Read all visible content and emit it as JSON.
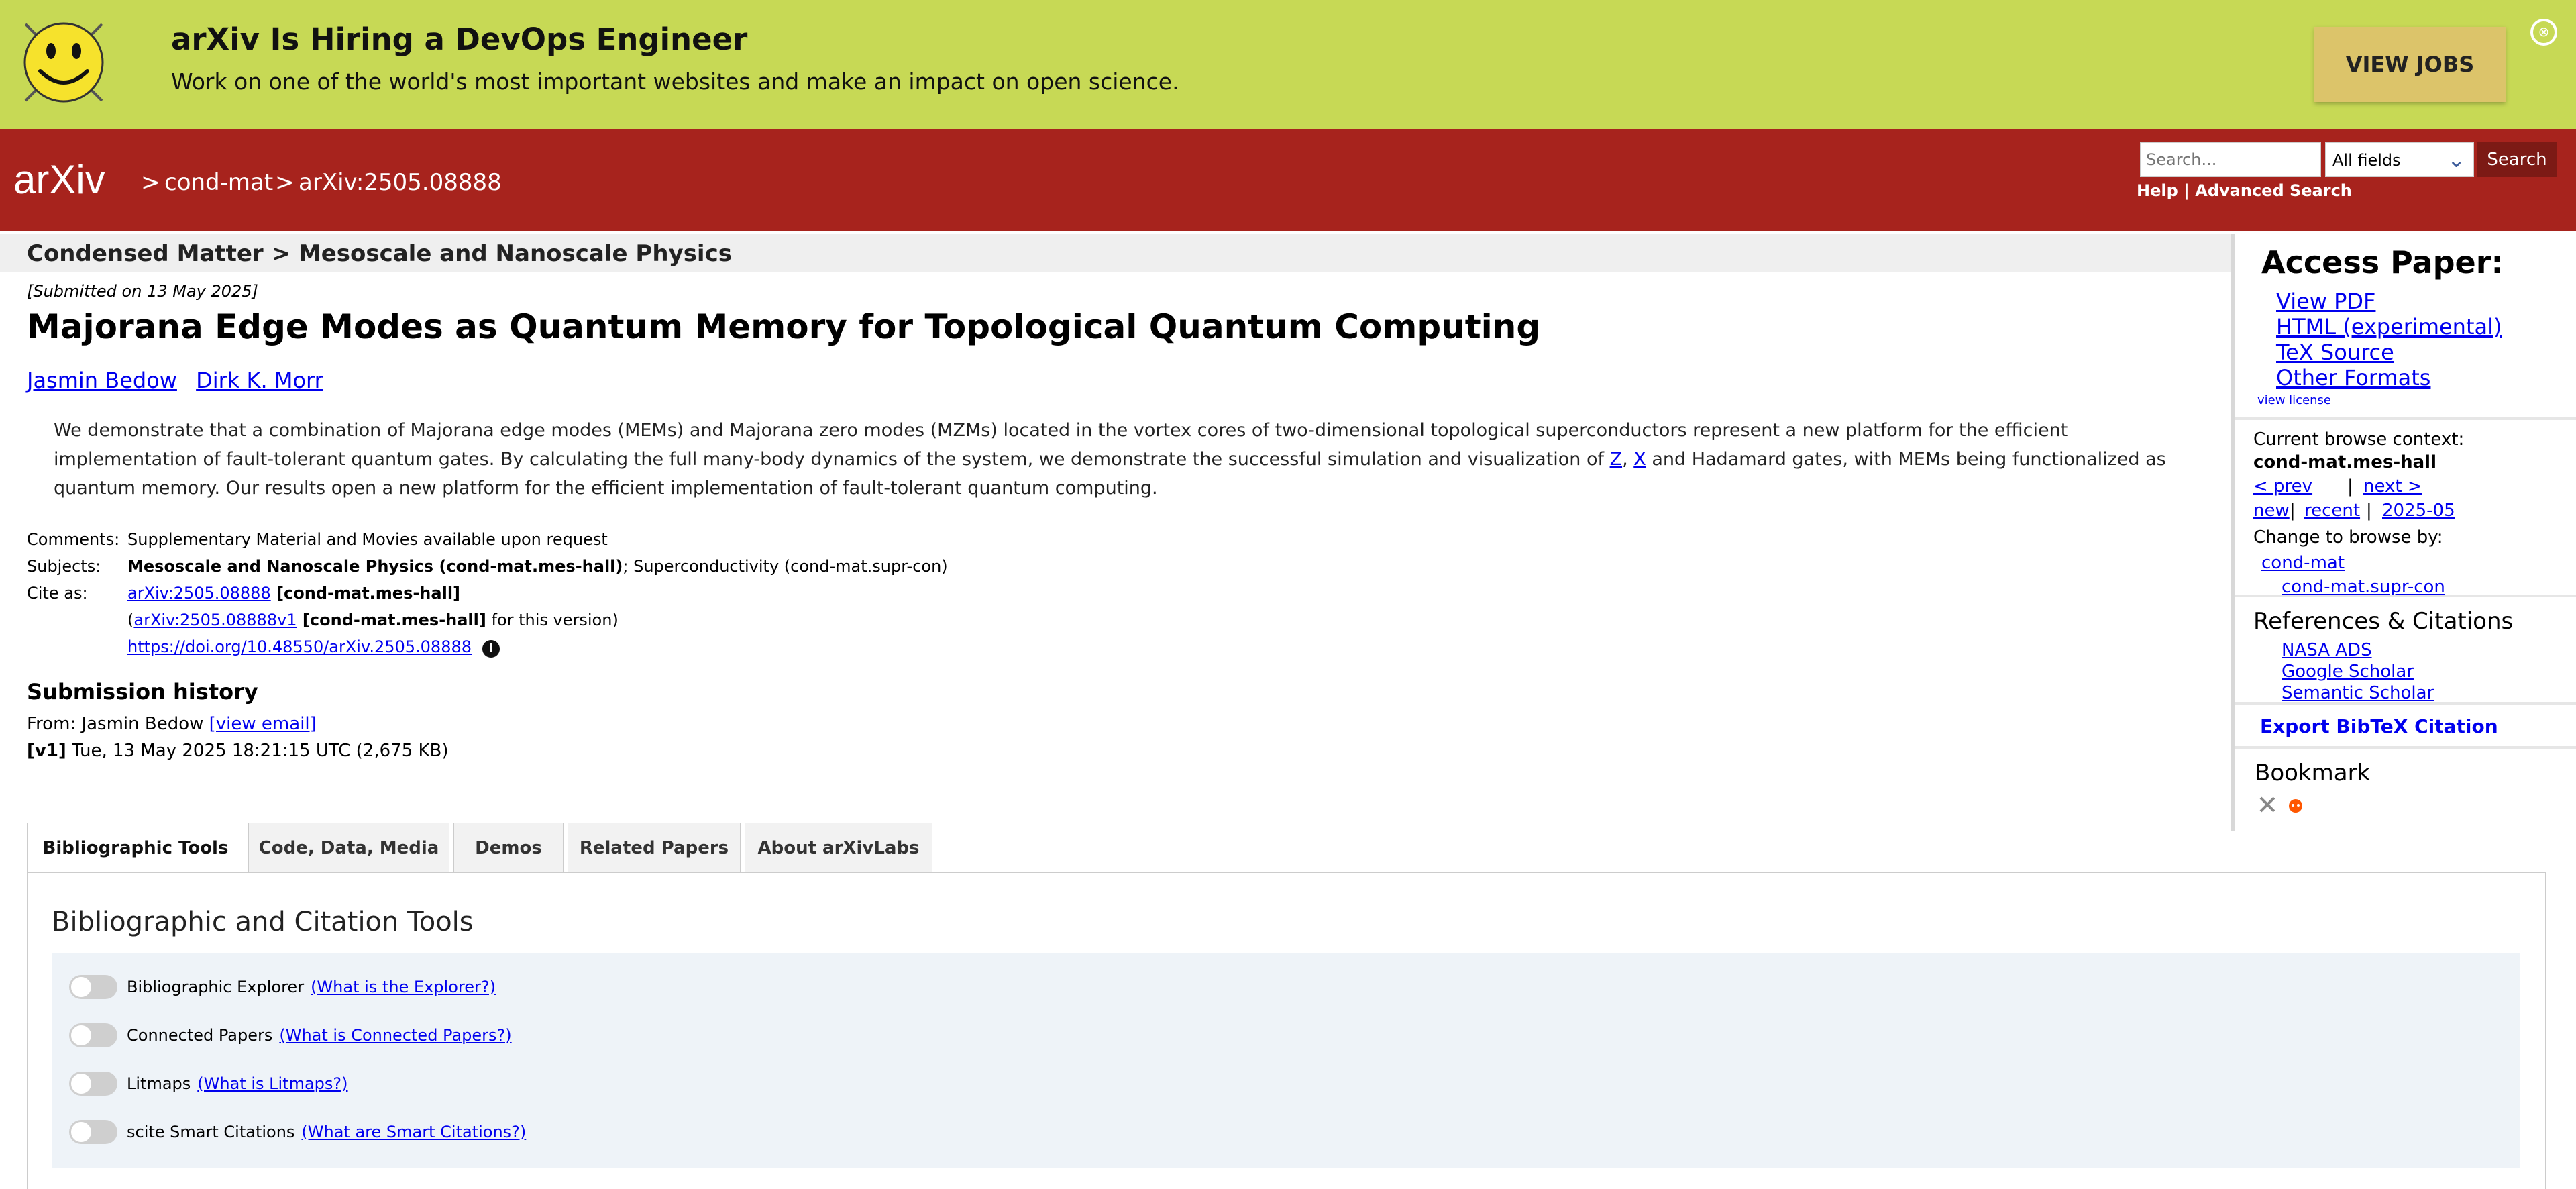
{
  "banner": {
    "title": "arXiv Is Hiring a DevOps Engineer",
    "subtitle": "Work on one of the world's most important websites and make an impact on open science.",
    "button_label": "VIEW JOBS",
    "close_glyph": "⊗"
  },
  "header": {
    "logo_text": "arXiv",
    "crumb_sep": ">",
    "category": "cond-mat",
    "paper_id": "arXiv:2505.08888",
    "search_placeholder": "Search...",
    "search_field": "All fields",
    "search_button": "Search",
    "help_label": "Help",
    "link_sep": "|",
    "advanced_label": "Advanced Search"
  },
  "paper": {
    "subject_bar": "Condensed Matter > Mesoscale and Nanoscale Physics",
    "submitted": "[Submitted on 13 May 2025]",
    "title": "Majorana Edge Modes as Quantum Memory for Topological Quantum Computing",
    "authors": [
      "Jasmin Bedow",
      "Dirk K. Morr"
    ],
    "abstract_a": "We demonstrate that a combination of Majorana edge modes (MEMs) and Majorana zero modes (MZMs) located in the vortex cores of two-dimensional topological superconductors represent a new platform for the efficient implementation of fault-tolerant quantum gates. By calculating the full many-body dynamics of the system, we demonstrate the successful simulation and visualization of ",
    "gate_z": "Z",
    "gate_comma": ", ",
    "gate_x": "X",
    "abstract_b": " and Hadamard gates, with MEMs being functionalized as quantum memory. Our results open a new platform for the efficient implementation of fault-tolerant quantum computing."
  },
  "meta": {
    "comments_label": "Comments:",
    "comments_value": "Supplementary Material and Movies available upon request",
    "subjects_label": "Subjects:",
    "subjects_primary": "Mesoscale and Nanoscale Physics (cond-mat.mes-hall)",
    "subjects_rest": "; Superconductivity (cond-mat.supr-con)",
    "cite_label": "Cite as:",
    "cite_link": "arXiv:2505.08888",
    "cite_cat": " [cond-mat.mes-hall]",
    "cite2_link": "arXiv:2505.08888v1",
    "cite2_cat": " [cond-mat.mes-hall]",
    "cite2_note": " for this version)",
    "cite2_open": "(",
    "doi": "https://doi.org/10.48550/arXiv.2505.08888",
    "info_glyph": "i"
  },
  "history": {
    "heading": "Submission history",
    "from_prefix": "From: Jasmin Bedow ",
    "view_email": "[view email]",
    "v1_label": "[v1]",
    "v1_text": " Tue, 13 May 2025 18:21:15 UTC (2,675 KB)"
  },
  "tabs": [
    "Bibliographic Tools",
    "Code, Data, Media",
    "Demos",
    "Related Papers",
    "About arXivLabs"
  ],
  "tools": {
    "title": "Bibliographic and Citation Tools",
    "items": [
      {
        "label": "Bibliographic Explorer",
        "help": "(What is the Explorer?)"
      },
      {
        "label": "Connected Papers",
        "help": "(What is Connected Papers?)"
      },
      {
        "label": "Litmaps",
        "help": "(What is Litmaps?)"
      },
      {
        "label": "scite Smart Citations",
        "help": "(What are Smart Citations?)"
      }
    ]
  },
  "sidebar": {
    "access_title": "Access Paper:",
    "links": [
      "View PDF",
      "HTML (experimental)",
      "TeX Source",
      "Other Formats"
    ],
    "view_license": "view license",
    "context_label": "Current browse context:",
    "context_value": "cond-mat.mes-hall",
    "prev": "< prev",
    "pipe": "|",
    "next": "next >",
    "new": "new",
    "recent": "recent",
    "month": "2025-05",
    "change_label": "Change to browse by:",
    "browse": [
      "cond-mat",
      "cond-mat.supr-con"
    ],
    "refs_title": "References & Citations",
    "refs": [
      "NASA ADS",
      "Google Scholar",
      "Semantic Scholar"
    ],
    "bibtex": "Export BibTeX Citation",
    "bookmark_title": "Bookmark",
    "bookmark_icons": [
      "bibsonomy-icon",
      "reddit-icon"
    ]
  },
  "colors": {
    "banner_bg": "#c7d955",
    "header_bg": "#a7231d",
    "link": "#0000ee"
  }
}
